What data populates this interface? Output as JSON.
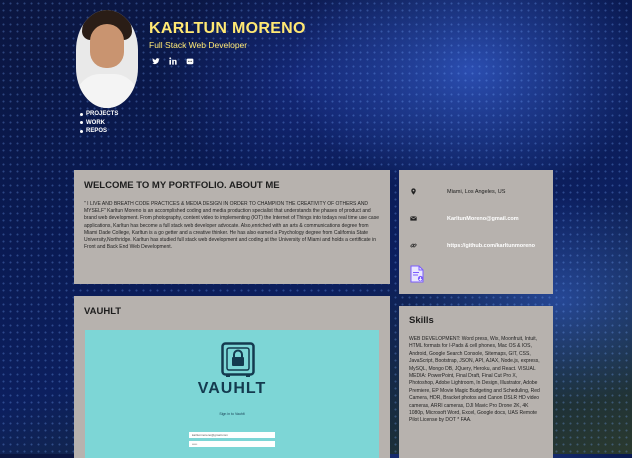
{
  "header": {
    "name": "KARLTUN MORENO",
    "title": "Full Stack Web Developer",
    "social_icons": [
      "twitter-icon",
      "linkedin-icon",
      "github-icon"
    ]
  },
  "nav": {
    "items": [
      "PROJECTS",
      "WORK",
      "REPOS"
    ]
  },
  "about": {
    "heading": "WELCOME TO MY PORTFOLIO. ABOUT ME",
    "body": "\" I LIVE AND BREATH CODE PRACTICES & MEDIA DESIGN IN ORDER TO CHAMPION THE CREATIVITY OF OTHERS AND MYSELF\" Karltun Moreno is an accomplished coding and media production specialist that understands the phases of product and brand web development. From photography, content video to implementing (IOT) the Internet of Things into todays real time use case applications, Karltun has become a full stack web developer advocate. Also,enriched with an arts & communications degree from Miami Dade College, Karltun is a go getter and a creative thinker. He has also earned a Psychology degree from California State University,Northridge. Karltun has studied full stack web development and coding at the University of Miami and holds a certificate in Front and Back End Web Development."
  },
  "contact": {
    "location": "Miami, Los Angeles, US",
    "email": "KarltunMoreno@gmail.com",
    "github": "https://github.com/karltunmoreno"
  },
  "project": {
    "heading": "VAUHLT",
    "screenshot": {
      "brand": "VAUHLT",
      "signin_label": "Sign in to Vauhlt",
      "email_value": "karltunmoreno@gmail.com",
      "password_value": "•••••"
    }
  },
  "skills": {
    "heading": "Skills",
    "body": "WEB DEVELOPMENT: Word press, Wix, Moonfruit, Intuit, HTML formats for I-Pads & cell phones, Mac OS & IOS, Android, Google Search Console, Sitemaps, GIT, CSS, JavaScript, Bootstrap, JSON, API, AJAX, Node.js, express, MySQL, Mongo DB, JQuery, Heroku, and React. VISUAL MEDIA: PowerPoint, Final Draft, Final Cut Pro X, Photoshop, Adobe Lightroom, In Design, Illustrator, Adobe Premiere, EP Movie Magic Budgeting and Scheduling, Red Camera, HDR, Bracket photos and Canon DSLR HD video cameras, ARRI cameras, DJI Mavic Pro Drone 2K, 4K 1080p, Microsoft Word, Excel, Google docs, UAS Remote Pilot License by DOT * FAA."
  },
  "colors": {
    "accent_yellow": "#ffe873",
    "card_bg": "#b7b2ae",
    "page_bg": "#0a1a52",
    "screenshot_bg": "#7dd6d6"
  }
}
